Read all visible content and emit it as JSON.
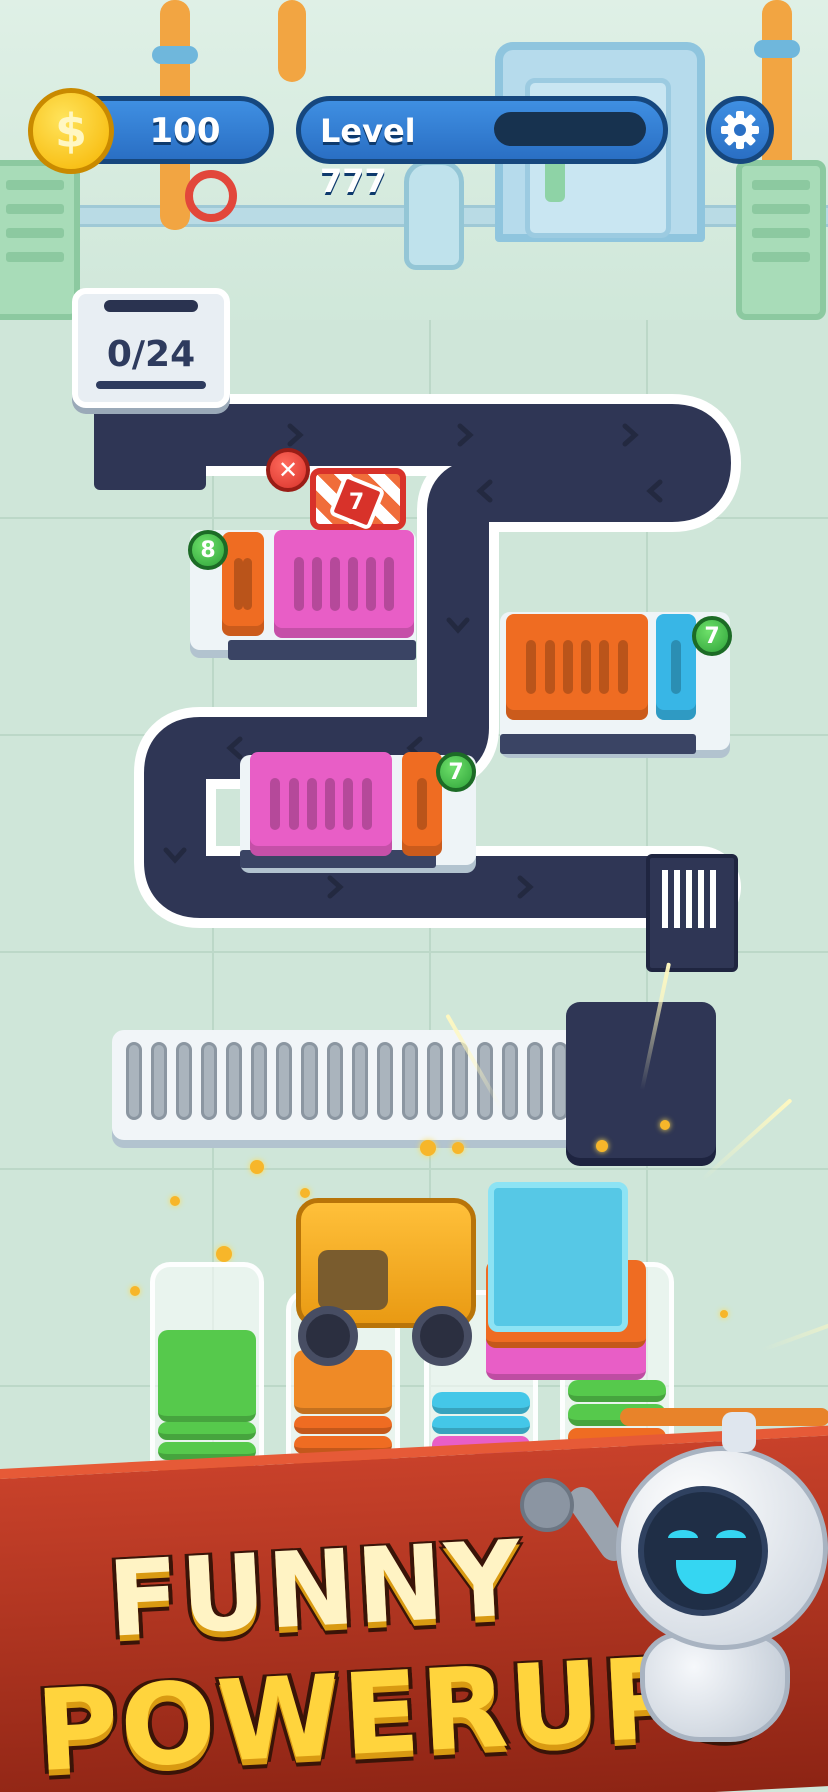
{
  "hud": {
    "coins": "100",
    "coin_symbol": "$",
    "level_label": "Level 777",
    "level_progress_fraction": 0.0,
    "settings_icon": "gear-icon"
  },
  "board": {
    "counter": "0/24",
    "shelves": [
      {
        "id": "upper-left",
        "badge": "8",
        "crates": [
          {
            "color": "#ef6c22",
            "bars": 2
          },
          {
            "color": "#e85ec6",
            "bars": 6
          }
        ]
      },
      {
        "id": "right",
        "badge": "7",
        "crates": [
          {
            "color": "#ef6c22",
            "bars": 6
          },
          {
            "color": "#38b6e6",
            "bars": 1
          }
        ]
      },
      {
        "id": "lower-left",
        "badge": "7",
        "crates": [
          {
            "color": "#e85ec6",
            "bars": 6
          },
          {
            "color": "#ef6c22",
            "bars": 1
          }
        ]
      }
    ],
    "blocked_crate_badge": "7",
    "lock_icon": "close-icon"
  },
  "promo": {
    "line1": "FUNNY",
    "line2": "POWERUPS"
  },
  "colors": {
    "hud_blue": "#2f7fd4",
    "belt": "#2f3655",
    "pink": "#e85ec6",
    "orange": "#ef6c22",
    "cyan": "#38b6e6",
    "green": "#4fc64a",
    "banner_red": "#b3321f",
    "promo_yellow": "#ffd43d"
  }
}
